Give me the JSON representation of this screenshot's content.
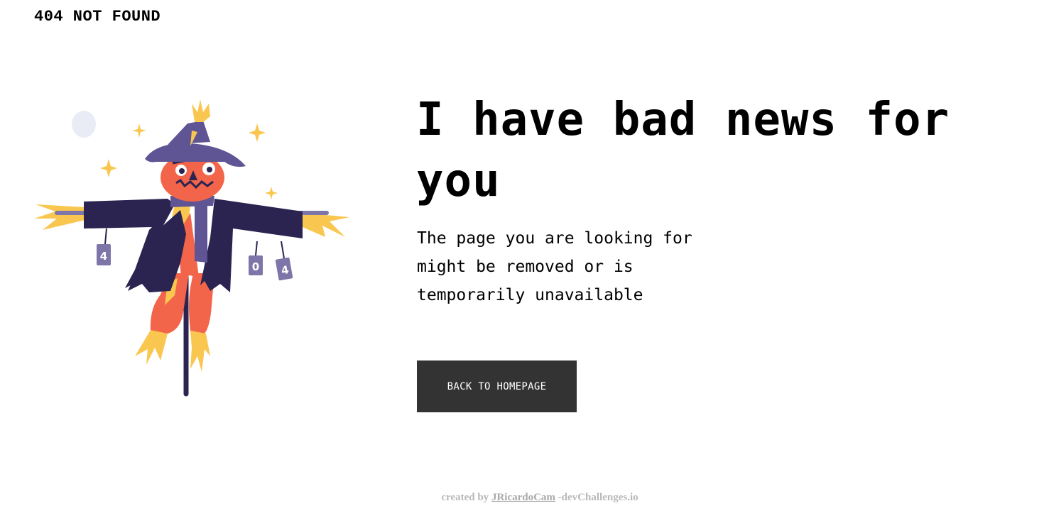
{
  "header": {
    "logo_text": "404 NOT FOUND"
  },
  "main": {
    "heading": "I have bad news for you",
    "subtitle": "The page you are looking for might be removed or is temporarily unavailable",
    "back_button_label": "BACK TO HOMEPAGE"
  },
  "illustration": {
    "can_labels": [
      "4",
      "0",
      "4"
    ]
  },
  "footer": {
    "prefix": "created by",
    "author_link": "JRicardoCam",
    "suffix": "-devChallenges.io"
  },
  "colors": {
    "background": "#ffffff",
    "button_background": "#333333",
    "button_text": "#ffffff",
    "footer_text": "#b8b8b8",
    "hat": "#5f5594",
    "coat": "#2b2450",
    "face": "#f2654a",
    "straw": "#f9c74f",
    "can": "#7e75a9",
    "moon": "#e9ecf5"
  }
}
